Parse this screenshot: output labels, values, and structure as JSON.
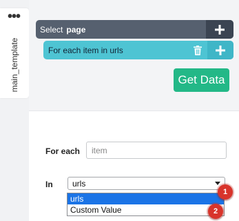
{
  "side_tab": {
    "menu_glyph": "•••",
    "label": "main_template"
  },
  "steps": {
    "select": {
      "verb": "Select",
      "target": "page"
    },
    "loop": {
      "label": "For each item in urls"
    }
  },
  "actions": {
    "get_data": "Get Data"
  },
  "form": {
    "for_each": {
      "label": "For each",
      "placeholder": "item"
    },
    "in": {
      "label": "In",
      "selected_value": "urls",
      "options": [
        "urls",
        "Custom Value"
      ],
      "highlighted_option": "urls"
    }
  },
  "annotations": [
    "1",
    "2"
  ],
  "colors": {
    "select_bar": "#56606f",
    "loop_bar": "#4ec4d3",
    "get_data_button": "#23b887",
    "badge": "#d8342b",
    "dropdown_highlight": "#1b74e6"
  }
}
